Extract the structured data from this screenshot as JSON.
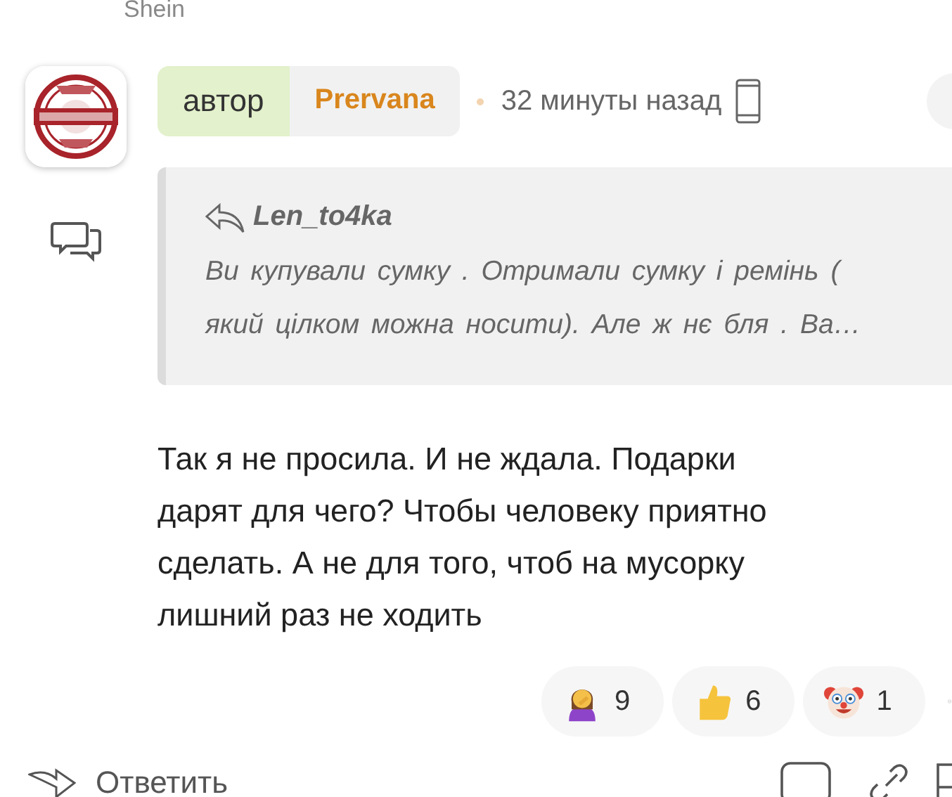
{
  "header_text": "Shein",
  "comment": {
    "author_badge": "автор",
    "author": "Prervana",
    "time": "32 минуты назад",
    "quote": {
      "author": "Len_to4ka",
      "lines": [
        "Ви купували сумку . Отримали сумку і ремінь (",
        "який цілком можна носити). Але ж нє бля . Ва…"
      ]
    },
    "text_lines": [
      "Так я не просила. И не ждала. Подарки",
      "дарят для чего? Чтобы человеку приятно",
      "сделать. А не для того, чтоб на мусорку",
      "лишний раз не ходить"
    ],
    "reactions": [
      {
        "kind": "facepalm",
        "count": "9"
      },
      {
        "kind": "thumbs_up",
        "count": "6"
      },
      {
        "kind": "clown",
        "count": "1"
      }
    ],
    "reply_label": "Ответить"
  }
}
